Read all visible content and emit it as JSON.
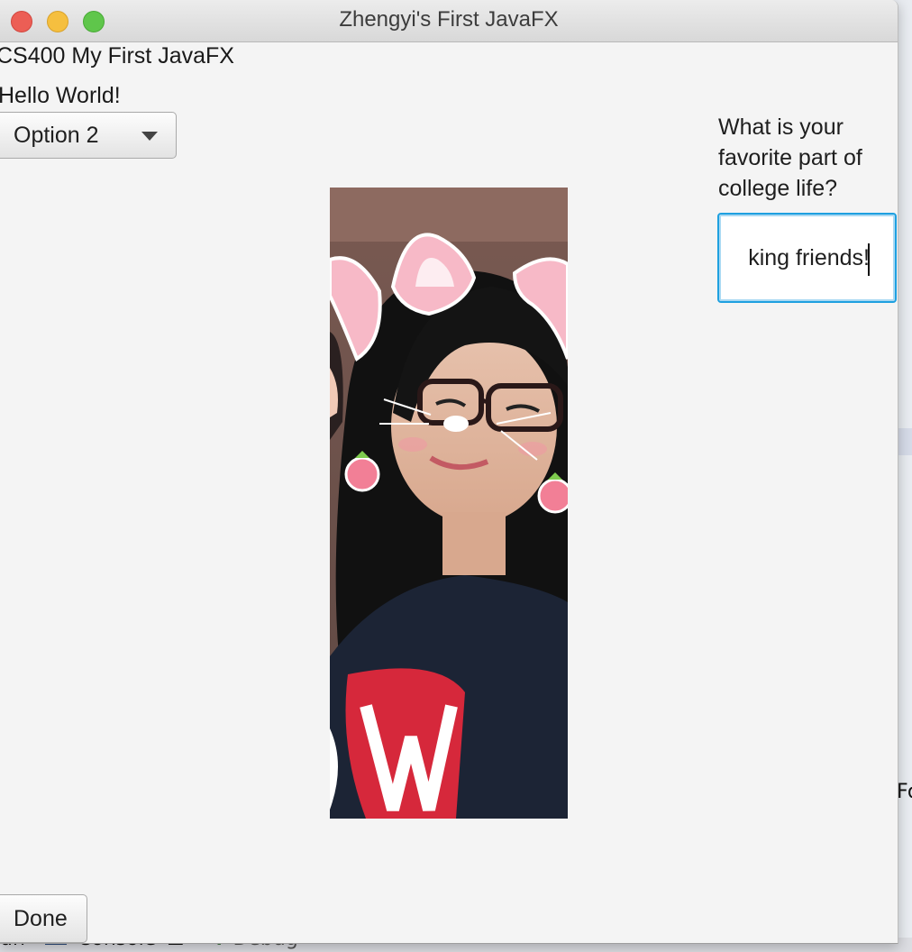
{
  "window": {
    "title": "Zhengyi's First JavaFX"
  },
  "labels": {
    "course": "CS400 My First JavaFX",
    "hello": "Hello World!"
  },
  "combo": {
    "selected": "Option 2"
  },
  "question": {
    "text": "What is your favorite part of college life?",
    "answer_visible": "king friends!"
  },
  "done_button": {
    "label": "Done"
  },
  "background_app": {
    "right_fragment": "Fo",
    "bottom_tabs": [
      "un",
      "Console",
      "Debug"
    ]
  },
  "colors": {
    "field_focus": "#1ea0e0",
    "window_bg": "#f4f4f4",
    "close": "#ec5e55",
    "minimize": "#f5bf3f",
    "maximize": "#5fc64b"
  },
  "icons": {
    "combo_arrow": "triangle-down",
    "photo": "profile-photo-with-cat-ears-filter"
  }
}
